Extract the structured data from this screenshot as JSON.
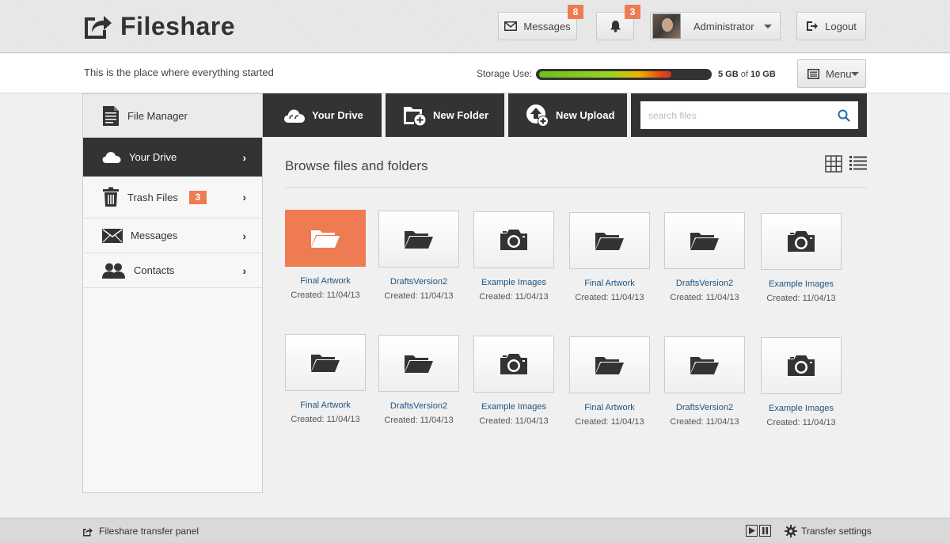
{
  "app": {
    "title": "Fileshare"
  },
  "header": {
    "messages_label": "Messages",
    "messages_count": "8",
    "notifications_count": "3",
    "user_name": "Administrator",
    "logout_label": "Logout"
  },
  "subheader": {
    "tagline": "This is the place where everything started",
    "storage_label": "Storage Use:",
    "storage_used": "5 GB",
    "storage_of": "of",
    "storage_total": "10 GB",
    "storage_fraction": 0.78,
    "menu_label": "Menu"
  },
  "sidebar": {
    "title": "File Manager",
    "items": [
      {
        "label": "Your Drive",
        "icon": "cloud-icon",
        "active": true
      },
      {
        "label": "Trash Files",
        "icon": "trash-icon",
        "badge": "3"
      },
      {
        "label": "Messages",
        "icon": "envelope-icon"
      },
      {
        "label": "Contacts",
        "icon": "contacts-icon"
      }
    ]
  },
  "toolbar": {
    "your_drive": "Your Drive",
    "new_folder": "New Folder",
    "new_upload": "New Upload",
    "search_placeholder": "search files"
  },
  "main": {
    "title": "Browse files and folders",
    "files": [
      {
        "name": "Final Artwork",
        "date": "Created: 11/04/13",
        "type": "folder",
        "selected": true
      },
      {
        "name": "DraftsVersion2",
        "date": "Created: 11/04/13",
        "type": "folder"
      },
      {
        "name": "Example Images",
        "date": "Created: 11/04/13",
        "type": "camera"
      },
      {
        "name": "Final Artwork",
        "date": "Created: 11/04/13",
        "type": "folder"
      },
      {
        "name": "DraftsVersion2",
        "date": "Created: 11/04/13",
        "type": "folder"
      },
      {
        "name": "Example Images",
        "date": "Created: 11/04/13",
        "type": "camera"
      },
      {
        "name": "Final Artwork",
        "date": "Created: 11/04/13",
        "type": "folder"
      },
      {
        "name": "DraftsVersion2",
        "date": "Created: 11/04/13",
        "type": "folder"
      },
      {
        "name": "Example Images",
        "date": "Created: 11/04/13",
        "type": "camera"
      },
      {
        "name": "Final Artwork",
        "date": "Created: 11/04/13",
        "type": "folder"
      },
      {
        "name": "DraftsVersion2",
        "date": "Created: 11/04/13",
        "type": "folder"
      },
      {
        "name": "Example Images",
        "date": "Created: 11/04/13",
        "type": "camera"
      }
    ]
  },
  "footer": {
    "transfer_panel": "Fileshare transfer panel",
    "transfer_settings": "Transfer settings"
  },
  "colors": {
    "accent": "#ef7b52",
    "dark": "#333333",
    "link": "#20557f"
  }
}
